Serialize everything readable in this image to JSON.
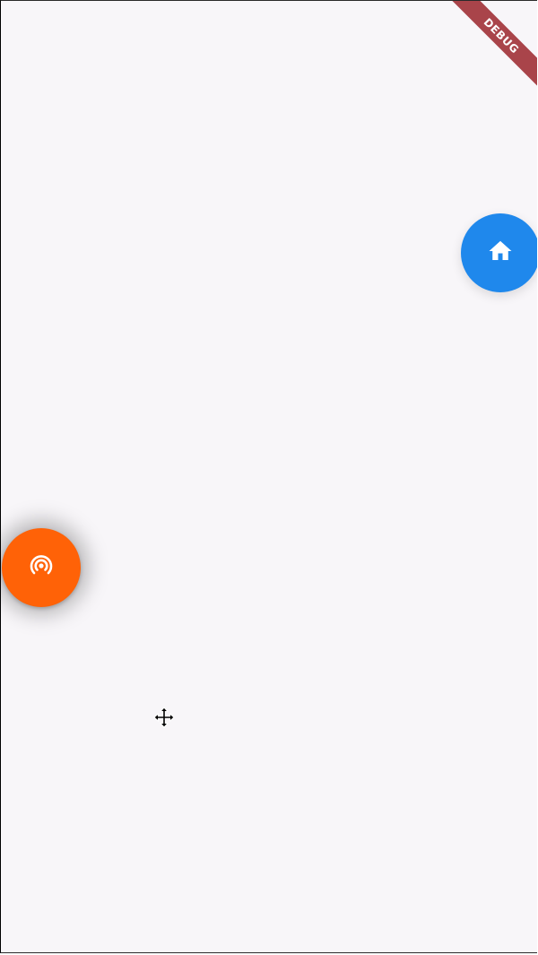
{
  "debug_banner": {
    "label": "DEBUG",
    "color": "#a9444a"
  },
  "buttons": {
    "home": {
      "icon": "home-icon",
      "color": "#1f88ec"
    },
    "podcast": {
      "icon": "podcast-icon",
      "color": "#ff6207"
    }
  },
  "cursor": {
    "icon": "move-cursor-icon"
  },
  "colors": {
    "background": "#f8f6f9"
  }
}
